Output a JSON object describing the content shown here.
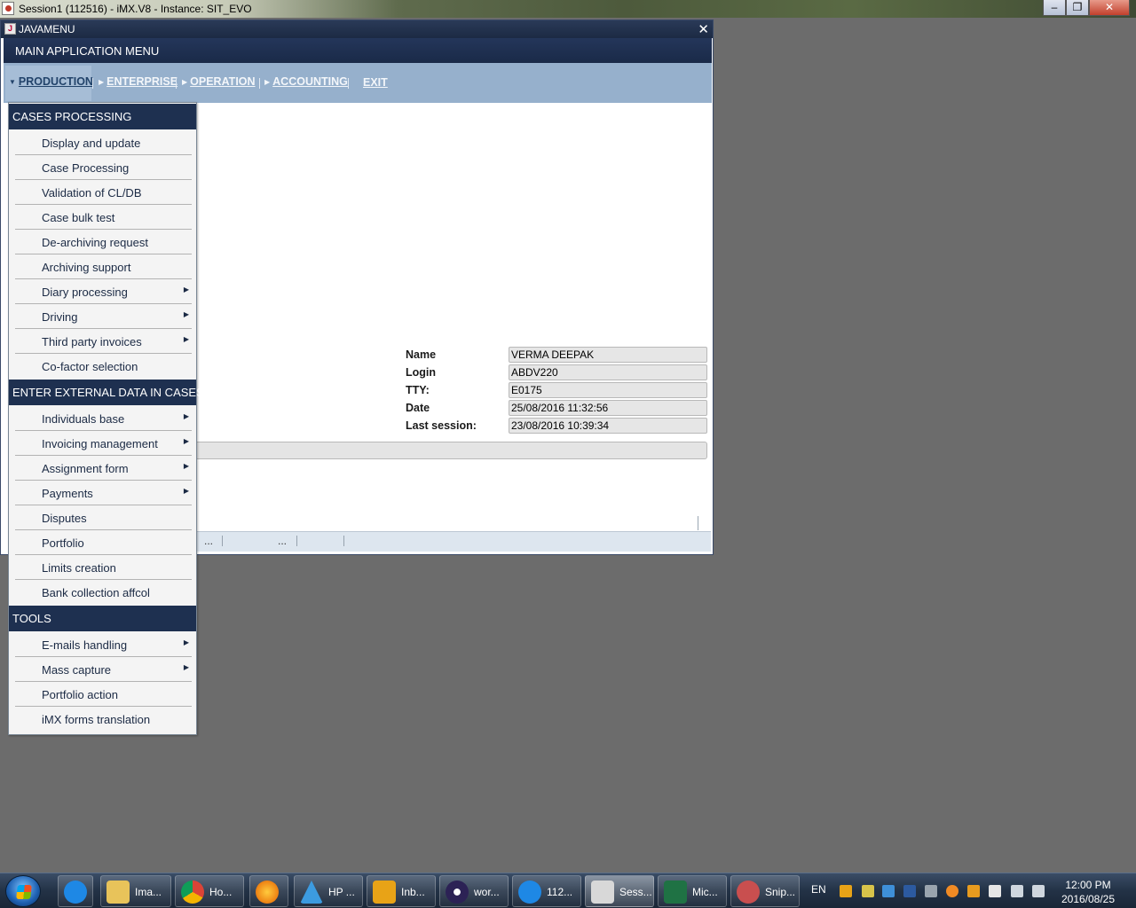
{
  "session_window": {
    "title": "Session1 (112516) - iMX.V8 - Instance: SIT_EVO",
    "controls": [
      "minimize-icon",
      "maximize-icon",
      "close-icon"
    ]
  },
  "java_window": {
    "title": "JAVAMENU",
    "close_glyph": "✕",
    "header": "MAIN APPLICATION MENU"
  },
  "menubar": {
    "items": [
      {
        "label": "PRODUCTION",
        "active": true
      },
      {
        "label": "ENTERPRISE",
        "active": false
      },
      {
        "label": "OPERATION",
        "active": false
      },
      {
        "label": "ACCOUNTING",
        "active": false
      },
      {
        "label": "EXIT",
        "active": false
      }
    ]
  },
  "user_info": {
    "fields": [
      {
        "label": "Name",
        "value": "VERMA DEEPAK"
      },
      {
        "label": "Login",
        "value": "ABDV220"
      },
      {
        "label": "TTY:",
        "value": "E0175"
      },
      {
        "label": "Date",
        "value": "25/08/2016 11:32:56"
      },
      {
        "label": "Last session:",
        "value": "23/08/2016 10:39:34"
      }
    ]
  },
  "statusbar": {
    "cells": [
      "...",
      "..."
    ]
  },
  "dropdown": {
    "sections": [
      {
        "title": "CASES PROCESSING",
        "items": [
          {
            "label": "Display and update",
            "submenu": false
          },
          {
            "label": "Case Processing",
            "submenu": false
          },
          {
            "label": "Validation of CL/DB",
            "submenu": false
          },
          {
            "label": "Case bulk test",
            "submenu": false
          },
          {
            "label": "De-archiving request",
            "submenu": false
          },
          {
            "label": "Archiving support",
            "submenu": false
          },
          {
            "label": "Diary processing",
            "submenu": true
          },
          {
            "label": "Driving",
            "submenu": true
          },
          {
            "label": "Third party invoices",
            "submenu": true
          },
          {
            "label": "Co-factor selection",
            "submenu": false
          }
        ]
      },
      {
        "title": "ENTER EXTERNAL DATA IN CASES",
        "items": [
          {
            "label": "Individuals base",
            "submenu": true
          },
          {
            "label": "Invoicing management",
            "submenu": true
          },
          {
            "label": "Assignment form",
            "submenu": true
          },
          {
            "label": "Payments",
            "submenu": true
          },
          {
            "label": "Disputes",
            "submenu": false
          },
          {
            "label": "Portfolio",
            "submenu": false
          },
          {
            "label": "Limits creation",
            "submenu": false
          },
          {
            "label": "Bank collection affcol",
            "submenu": false
          }
        ]
      },
      {
        "title": "TOOLS",
        "items": [
          {
            "label": "E-mails handling",
            "submenu": true
          },
          {
            "label": "Mass capture",
            "submenu": true
          },
          {
            "label": "Portfolio action",
            "submenu": false
          },
          {
            "label": "iMX forms translation",
            "submenu": false
          }
        ]
      }
    ]
  },
  "taskbar": {
    "buttons": [
      {
        "label": "",
        "icon": "internet-explorer-icon",
        "color": "#1e88e5"
      },
      {
        "label": "Ima...",
        "icon": "folder-icon",
        "color": "#e8c35a"
      },
      {
        "label": "Ho...",
        "icon": "chrome-icon",
        "color": "#db4437"
      },
      {
        "label": "",
        "icon": "firefox-icon",
        "color": "#e66000"
      },
      {
        "label": "HP ...",
        "icon": "hp-alm-icon",
        "color": "#3c9be0"
      },
      {
        "label": "Inb...",
        "icon": "outlook-icon",
        "color": "#e8a317"
      },
      {
        "label": "wor...",
        "icon": "eclipse-icon",
        "color": "#2c2255"
      },
      {
        "label": "112...",
        "icon": "internet-explorer-icon",
        "color": "#1e88e5"
      },
      {
        "label": "Sess...",
        "icon": "java-icon",
        "color": "#d8d8d8",
        "active": true
      },
      {
        "label": "Mic...",
        "icon": "excel-icon",
        "color": "#1f7244"
      },
      {
        "label": "Snip...",
        "icon": "snipping-tool-icon",
        "color": "#c94f4f"
      }
    ],
    "language": "EN",
    "clock_time": "12:00 PM",
    "clock_date": "2016/08/25"
  }
}
